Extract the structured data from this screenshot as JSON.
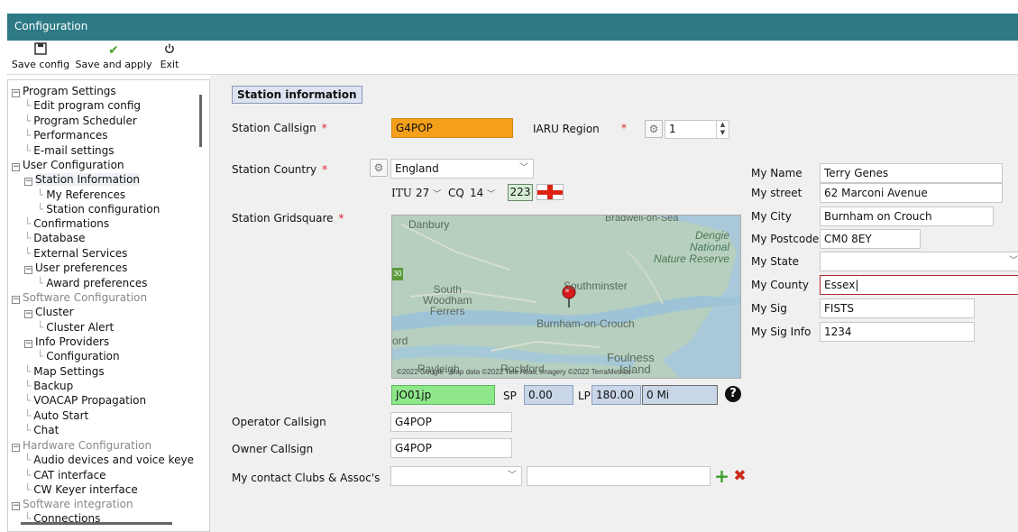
{
  "window": {
    "title": "Configuration"
  },
  "toolbar": {
    "save_config": "Save config",
    "save_apply": "Save and apply",
    "exit": "Exit"
  },
  "tree": [
    {
      "label": "Program Settings",
      "level": 0,
      "expander": "minus",
      "style": "normal"
    },
    {
      "label": "Edit program config",
      "level": 1,
      "style": "normal"
    },
    {
      "label": "Program Scheduler",
      "level": 1,
      "style": "normal"
    },
    {
      "label": "Performances",
      "level": 1,
      "style": "normal"
    },
    {
      "label": "E-mail settings",
      "level": 1,
      "style": "normal"
    },
    {
      "label": "User Configuration",
      "level": 0,
      "expander": "minus",
      "style": "normal"
    },
    {
      "label": "Station Information",
      "level": 1,
      "expander": "minus",
      "style": "selected"
    },
    {
      "label": "My References",
      "level": 2,
      "style": "normal"
    },
    {
      "label": "Station configuration",
      "level": 2,
      "style": "normal"
    },
    {
      "label": "Confirmations",
      "level": 1,
      "style": "normal"
    },
    {
      "label": "Database",
      "level": 1,
      "style": "normal"
    },
    {
      "label": "External Services",
      "level": 1,
      "style": "normal"
    },
    {
      "label": "User preferences",
      "level": 1,
      "expander": "minus",
      "style": "normal"
    },
    {
      "label": "Award preferences",
      "level": 2,
      "style": "normal"
    },
    {
      "label": "Software Configuration",
      "level": 0,
      "expander": "minus",
      "style": "gray"
    },
    {
      "label": "Cluster",
      "level": 1,
      "expander": "minus",
      "style": "normal"
    },
    {
      "label": "Cluster Alert",
      "level": 2,
      "style": "normal"
    },
    {
      "label": "Info Providers",
      "level": 1,
      "expander": "minus",
      "style": "normal"
    },
    {
      "label": "Configuration",
      "level": 2,
      "style": "normal"
    },
    {
      "label": "Map Settings",
      "level": 1,
      "style": "normal"
    },
    {
      "label": "Backup",
      "level": 1,
      "style": "normal"
    },
    {
      "label": "VOACAP Propagation",
      "level": 1,
      "style": "normal"
    },
    {
      "label": "Auto Start",
      "level": 1,
      "style": "normal"
    },
    {
      "label": "Chat",
      "level": 1,
      "style": "normal"
    },
    {
      "label": "Hardware Configuration",
      "level": 0,
      "expander": "minus",
      "style": "gray"
    },
    {
      "label": "Audio devices and voice keye",
      "level": 1,
      "style": "normal"
    },
    {
      "label": "CAT interface",
      "level": 1,
      "style": "normal"
    },
    {
      "label": "CW Keyer interface",
      "level": 1,
      "style": "normal"
    },
    {
      "label": "Software integration",
      "level": 0,
      "expander": "minus",
      "style": "gray"
    },
    {
      "label": "Connections",
      "level": 1,
      "style": "normal"
    }
  ],
  "section": {
    "title": "Station information"
  },
  "callsign": {
    "label": "Station Callsign",
    "value": "G4POP",
    "highlight": "#f5a01a"
  },
  "iaru": {
    "label": "IARU Region",
    "value": "1"
  },
  "country": {
    "label": "Station Country",
    "value": "England",
    "itu_label": "ITU",
    "itu": "27",
    "cq_label": "CQ",
    "cq": "14",
    "dxcc": "223"
  },
  "gridsquare": {
    "label": "Station Gridsquare",
    "value": "JO01jp",
    "highlight": "#8ee88a",
    "sp_label": "SP",
    "sp": "0.00",
    "lp_label": "LP",
    "lp": "180.00",
    "distance": "0 Mi"
  },
  "map": {
    "places": [
      "Danbury",
      "Dengie",
      "National",
      "Nature Reserve",
      "Southminster",
      "South",
      "Woodham",
      "Ferrers",
      "Burnham-on-Crouch",
      "ord",
      "Foulness",
      "Island",
      "Rayleigh",
      "Rochford",
      "Bradwell-on-Sea"
    ],
    "badge": "30",
    "attribution": "©2022 Google - Map data ©2022 Tele Atlas, Imagery ©2022 TerraMetrics"
  },
  "operator": {
    "label": "Operator Callsign",
    "value": "G4POP"
  },
  "owner": {
    "label": "Owner Callsign",
    "value": "G4POP"
  },
  "clubs": {
    "label": "My contact Clubs & Assoc's",
    "value": "",
    "input": ""
  },
  "personal": [
    {
      "label": "My Name",
      "value": "Terry Genes"
    },
    {
      "label": "My street",
      "value": "62 Marconi Avenue"
    },
    {
      "label": "My City",
      "value": "Burnham on Crouch"
    },
    {
      "label": "My Postcode",
      "value": "CM0 8EY"
    },
    {
      "label": "My State",
      "value": ""
    },
    {
      "label": "My County",
      "value": "Essex"
    },
    {
      "label": "My Sig",
      "value": "FISTS"
    },
    {
      "label": "My Sig Info",
      "value": "1234"
    }
  ]
}
